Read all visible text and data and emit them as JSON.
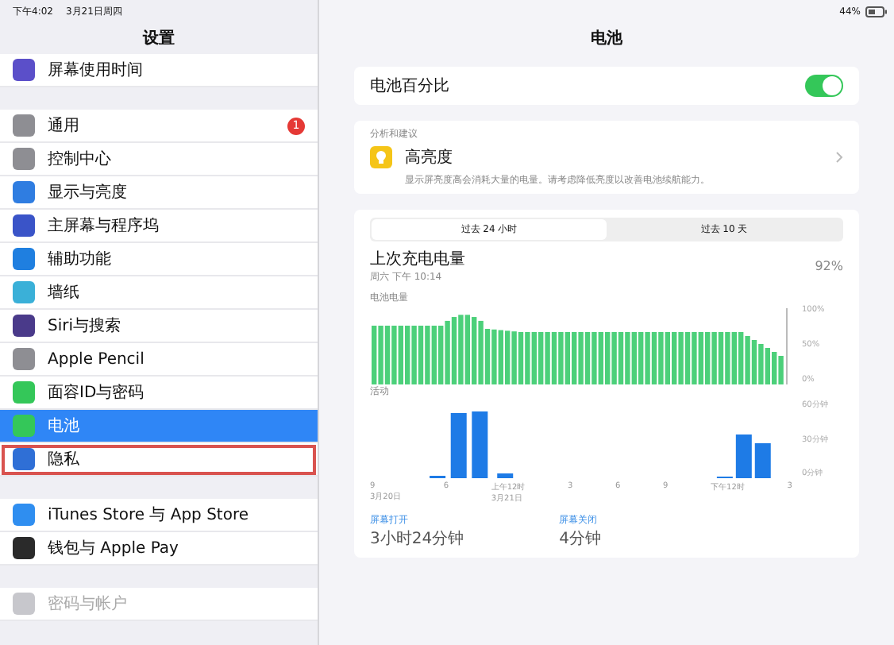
{
  "status_bar": {
    "time": "下午4:02",
    "date": "3月21日周四",
    "battery": "44%"
  },
  "sidebar": {
    "title": "设置",
    "groups": [
      [
        {
          "label": "屏幕使用时间",
          "color": "#5b4fc9",
          "selected": false,
          "outlined": false,
          "disabled": false
        }
      ],
      [
        {
          "label": "通用",
          "color": "#8e8e93",
          "selected": false,
          "outlined": false,
          "disabled": false,
          "badge": "1"
        },
        {
          "label": "控制中心",
          "color": "#8e8e93",
          "selected": false,
          "outlined": false,
          "disabled": false
        },
        {
          "label": "显示与亮度",
          "color": "#2f7de1",
          "selected": false,
          "outlined": false,
          "disabled": false
        },
        {
          "label": "主屏幕与程序坞",
          "color": "#3a54c8",
          "selected": false,
          "outlined": false,
          "disabled": false
        },
        {
          "label": "辅助功能",
          "color": "#1f7fe0",
          "selected": false,
          "outlined": false,
          "disabled": false
        },
        {
          "label": "墙纸",
          "color": "#3ab0d8",
          "selected": false,
          "outlined": false,
          "disabled": false
        },
        {
          "label": "Siri与搜索",
          "color": "#4a3a8a",
          "selected": false,
          "outlined": false,
          "disabled": false
        },
        {
          "label": "Apple Pencil",
          "color": "#8e8e93",
          "selected": false,
          "outlined": false,
          "disabled": false
        },
        {
          "label": "面容ID与密码",
          "color": "#34c759",
          "selected": false,
          "outlined": false,
          "disabled": false
        },
        {
          "label": "电池",
          "color": "#34c759",
          "selected": true,
          "outlined": false,
          "disabled": false
        },
        {
          "label": "隐私",
          "color": "#2f6fd6",
          "selected": false,
          "outlined": true,
          "disabled": false
        }
      ],
      [
        {
          "label": "iTunes Store 与 App Store",
          "color": "#2f8ef0",
          "selected": false,
          "outlined": false,
          "disabled": false
        },
        {
          "label": "钱包与 Apple Pay",
          "color": "#2a2a2a",
          "selected": false,
          "outlined": false,
          "disabled": false
        }
      ],
      [
        {
          "label": "密码与帐户",
          "color": "#c7c7cc",
          "selected": false,
          "outlined": false,
          "disabled": true
        }
      ]
    ]
  },
  "detail": {
    "title": "电池",
    "percentage": {
      "label": "电池百分比",
      "on": true
    },
    "suggestion": {
      "heading": "分析和建议",
      "title": "高亮度",
      "text": "显示屏亮度高会消耗大量的电量。请考虑降低亮度以改善电池续航能力。"
    },
    "tabs": [
      {
        "label": "过去 24 小时",
        "selected": true
      },
      {
        "label": "过去 10 天",
        "selected": false
      }
    ],
    "last_charge": {
      "label": "上次充电电量",
      "time": "周六 下午 10:14",
      "value": "92%"
    },
    "battery_chart": {
      "label": "电池电量",
      "ticks": [
        "100%",
        "50%",
        "0%"
      ]
    },
    "activity_chart": {
      "label": "活动",
      "ticks": [
        "60分钟",
        "30分钟",
        "0分钟"
      ],
      "x_labels": [
        {
          "time": "9",
          "date": "3月20日"
        },
        {
          "time": "6"
        },
        {
          "time": "上午12时",
          "date": "3月21日"
        },
        {
          "time": "3"
        },
        {
          "time": "6"
        },
        {
          "time": "9"
        },
        {
          "time": "下午12时"
        },
        {
          "time": "3"
        }
      ]
    },
    "stats": [
      {
        "label": "屏幕打开",
        "value": "3小时24分钟"
      },
      {
        "label": "屏幕关闭",
        "value": "4分钟"
      }
    ]
  }
}
